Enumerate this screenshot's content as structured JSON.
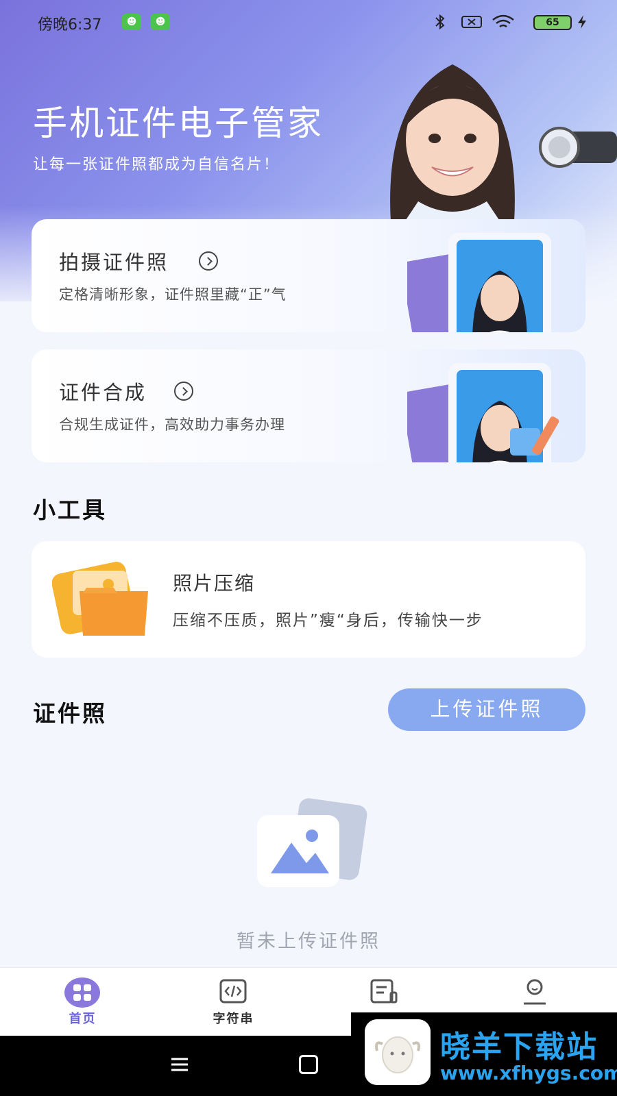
{
  "status_bar": {
    "time": "傍晚6:37",
    "battery": "65",
    "icons": [
      "app-badge-icon",
      "app-badge-icon",
      "bluetooth-icon",
      "sim-icon",
      "wifi-icon",
      "battery-icon",
      "charging-icon"
    ]
  },
  "hero": {
    "title": "手机证件电子管家",
    "subtitle": "让每一张证件照都成为自信名片！"
  },
  "cards": [
    {
      "title": "拍摄证件照",
      "desc": "定格清晰形象，证件照里藏“正”气"
    },
    {
      "title": "证件合成",
      "desc": "合规生成证件，高效助力事务办理"
    }
  ],
  "tools": {
    "section_title": "小工具",
    "items": [
      {
        "title": "照片压缩",
        "desc": "压缩不压质，照片”瘦“身后，传输快一步"
      }
    ]
  },
  "id_photos": {
    "section_title": "证件照",
    "upload_label": "上传证件照",
    "empty_text": "暂未上传证件照"
  },
  "tab_bar": {
    "tabs": [
      {
        "label": "首页",
        "icon": "home-grid-icon",
        "active": true
      },
      {
        "label": "字符串",
        "icon": "code-icon",
        "active": false
      },
      {
        "label": "",
        "icon": "document-icon",
        "active": false
      },
      {
        "label": "",
        "icon": "profile-icon",
        "active": false
      }
    ]
  },
  "watermark": {
    "name": "晓羊下载站",
    "url": "www.xfhygs.com"
  },
  "colors": {
    "hero_gradient_start": "#7a72dc",
    "accent": "#6a62d8",
    "upload_button": "#88a8ef",
    "background": "#f3f6fd",
    "watermark_text": "#2aa3f0"
  }
}
